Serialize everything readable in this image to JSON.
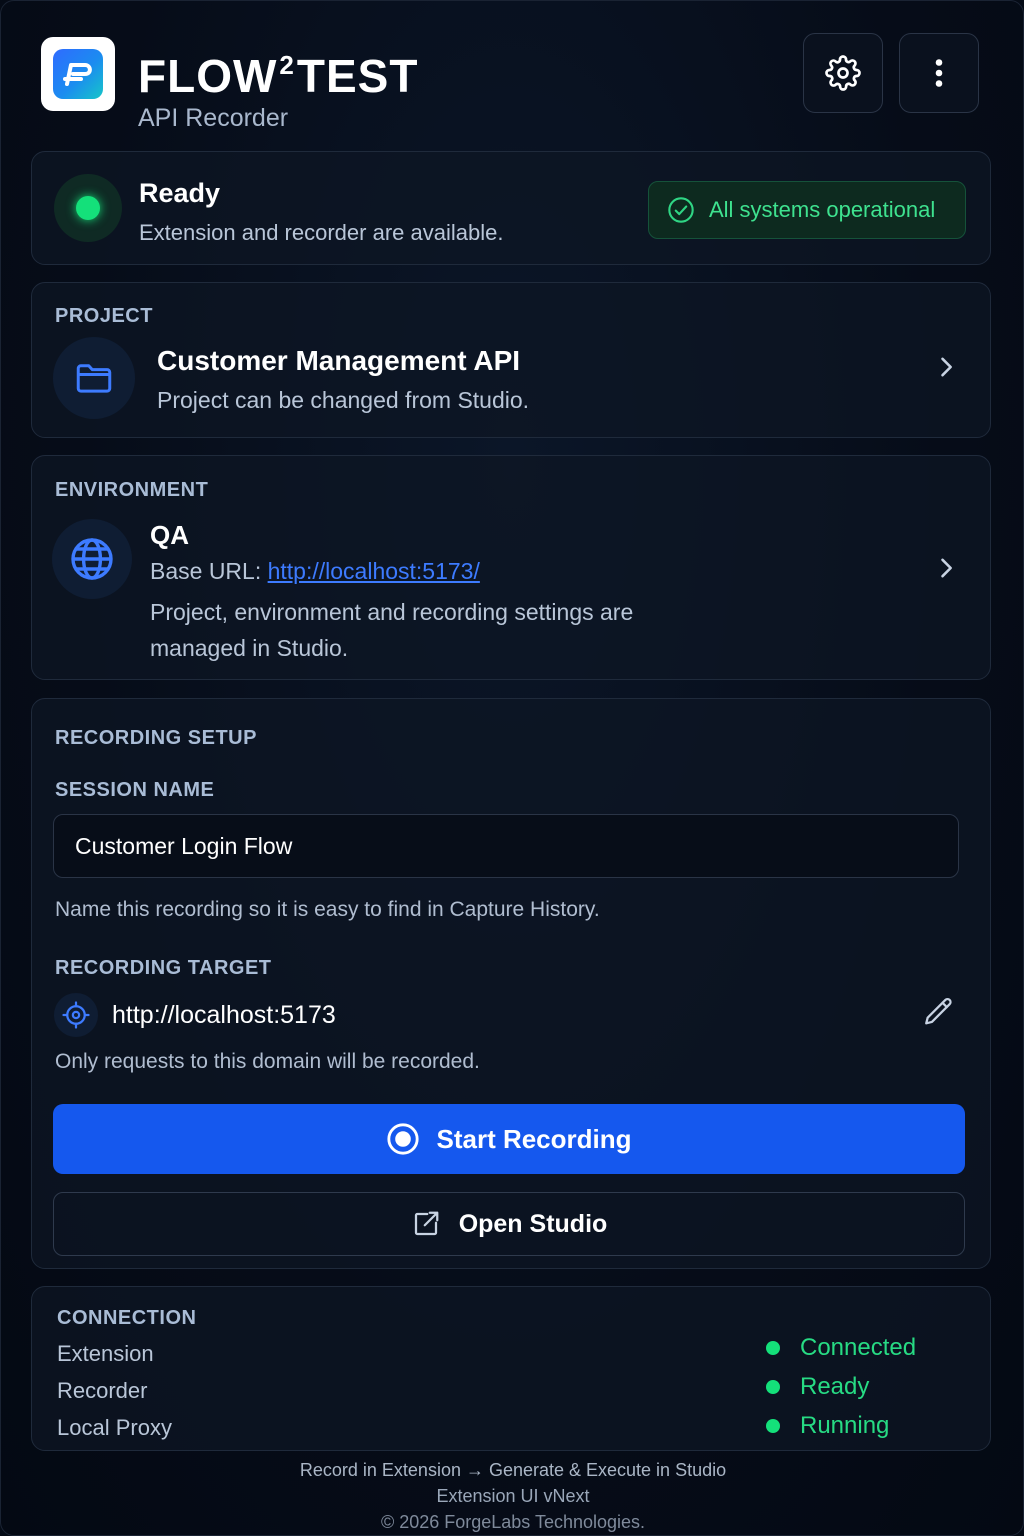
{
  "header": {
    "brand_prefix": "FLOW",
    "brand_sup": "2",
    "brand_suffix": "TEST",
    "subtitle": "API Recorder"
  },
  "status": {
    "title": "Ready",
    "description": "Extension and recorder are available.",
    "badge": "All systems operational"
  },
  "project": {
    "label": "PROJECT",
    "name": "Customer Management API",
    "description": "Project can be changed from Studio."
  },
  "environment": {
    "label": "ENVIRONMENT",
    "name": "QA",
    "base_url_label": "Base URL:",
    "base_url": "http://localhost:5173/",
    "description": "Project, environment and recording settings are managed in Studio."
  },
  "recording": {
    "section_label": "RECORDING SETUP",
    "session_label": "SESSION NAME",
    "session_value": "Customer Login Flow",
    "session_help": "Name this recording so it is easy to find in Capture History.",
    "target_label": "RECORDING TARGET",
    "target_url": "http://localhost:5173",
    "target_help": "Only requests to this domain will be recorded.",
    "start_label": "Start Recording",
    "studio_label": "Open Studio"
  },
  "connection": {
    "label": "CONNECTION",
    "rows": [
      {
        "name": "Extension",
        "status": "Connected"
      },
      {
        "name": "Recorder",
        "status": "Ready"
      },
      {
        "name": "Local Proxy",
        "status": "Running"
      }
    ]
  },
  "footer": {
    "line1": "Record in Extension → Generate & Execute in Studio",
    "line2": "Extension UI vNext",
    "line3": "© 2026 ForgeLabs Technologies."
  },
  "colors": {
    "accent": "#1558ee",
    "success": "#14e07a",
    "link": "#3d7bff"
  }
}
